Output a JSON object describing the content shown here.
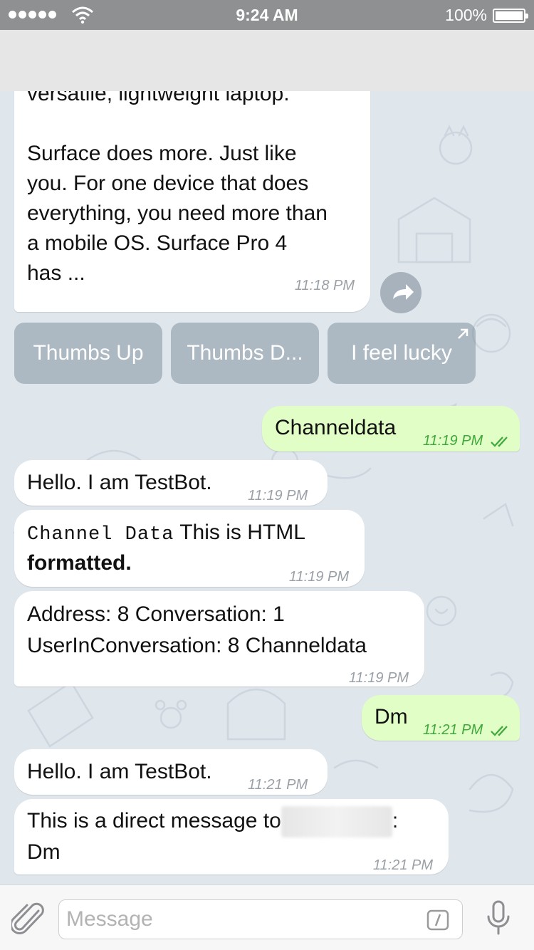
{
  "status_bar": {
    "time": "9:24 AM",
    "battery_percent": "100%",
    "battery_level": 1.0,
    "signal_icon": "signal-dots-icon",
    "wifi_icon": "wifi-icon",
    "battery_icon": "battery-icon"
  },
  "colors": {
    "outgoing_bubble": "#e1fec6",
    "incoming_bubble": "#ffffff",
    "read_tick": "#3ea83a",
    "background": "#dfe6ec"
  },
  "messages": [
    {
      "direction": "incoming",
      "line1": "versatile, lightweight laptop.",
      "line2": "Surface does more. Just like",
      "line3": "you. For one device that does",
      "line4": "everything, you need more than",
      "line5": "a mobile OS. Surface Pro 4",
      "line6": "has ...",
      "time": "11:18 PM"
    },
    {
      "direction": "outgoing",
      "text": "Channeldata",
      "time": "11:19 PM",
      "status": "read"
    },
    {
      "direction": "incoming",
      "text": "Hello. I am TestBot.",
      "time": "11:19 PM"
    },
    {
      "direction": "incoming",
      "code": "Channel Data",
      "line1": "This is HTML",
      "line2": "formatted.",
      "time": "11:19 PM"
    },
    {
      "direction": "incoming",
      "line1": "Address: 8 Conversation: 1",
      "line2": "UserInConversation: 8 Channeldata",
      "time": "11:19 PM"
    },
    {
      "direction": "outgoing",
      "text": "Dm",
      "time": "11:21 PM",
      "status": "read"
    },
    {
      "direction": "incoming",
      "text": "Hello. I am TestBot.",
      "time": "11:21 PM"
    },
    {
      "direction": "incoming",
      "line1": "This is a direct message to",
      "suffix": ":",
      "line2": "Dm",
      "time": "11:21 PM"
    }
  ],
  "inline_keyboard": [
    {
      "label": "Thumbs Up"
    },
    {
      "label": "Thumbs D..."
    },
    {
      "label": "I feel lucky",
      "icon": "external-link-icon"
    }
  ],
  "share_icon": "share-arrow-icon",
  "input": {
    "placeholder": "Message",
    "value": "",
    "attach_icon": "paperclip-icon",
    "command_icon": "bot-command-icon",
    "mic_icon": "microphone-icon"
  }
}
